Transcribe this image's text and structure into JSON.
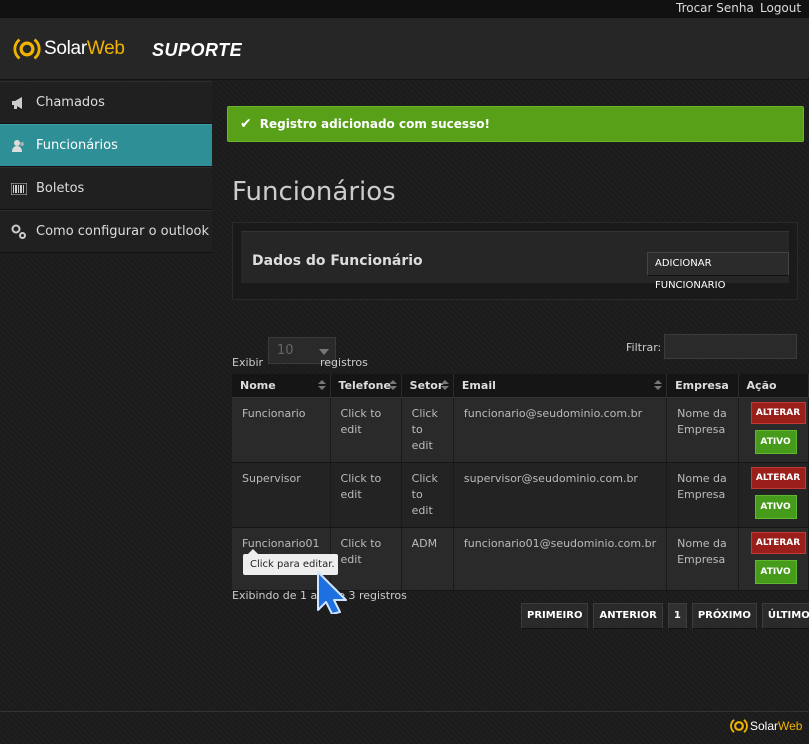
{
  "topbar": {
    "change_password": "Trocar Senha",
    "logout": "Logout"
  },
  "header": {
    "brand_a": "Solar",
    "brand_b": "Web",
    "section": "SUPORTE"
  },
  "sidebar": {
    "items": [
      {
        "label": "Chamados",
        "icon": "megaphone-icon"
      },
      {
        "label": "Funcionários",
        "icon": "users-icon"
      },
      {
        "label": "Boletos",
        "icon": "barcode-icon"
      },
      {
        "label": "Como configurar o outlook",
        "icon": "gears-icon"
      }
    ]
  },
  "alert": {
    "message": "Registro adicionado com sucesso!",
    "color": "#57a018"
  },
  "page": {
    "title": "Funcionários"
  },
  "panel": {
    "title": "Dados do Funcionário",
    "add_button": "ADICIONAR FUNCIONARIO"
  },
  "table_controls": {
    "show_label": "Exibir",
    "page_size": "10",
    "records_label": "registros",
    "filter_label": "Filtrar:"
  },
  "table": {
    "headers": [
      "Nome",
      "Telefone",
      "Setor",
      "Email",
      "Empresa",
      "Ação"
    ],
    "rows": [
      {
        "nome": "Funcionario",
        "telefone": "Click to edit",
        "setor": "Click to edit",
        "email": "funcionario@seudominio.com.br",
        "empresa": "Nome da Empresa",
        "alterar": "ALTERAR",
        "ativo": "ATIVO"
      },
      {
        "nome": "Supervisor",
        "telefone": "Click to edit",
        "setor": "Click to edit",
        "email": "supervisor@seudominio.com.br",
        "empresa": "Nome da Empresa",
        "alterar": "ALTERAR",
        "ativo": "ATIVO"
      },
      {
        "nome": "Funcionario01",
        "telefone": "Click to edit",
        "setor": "ADM",
        "email": "funcionario01@seudominio.com.br",
        "empresa": "Nome da Empresa",
        "alterar": "ALTERAR",
        "ativo": "ATIVO"
      }
    ]
  },
  "tooltip": {
    "text": "Click para editar."
  },
  "info": {
    "text": "Exibindo de 1 a 3 de 3 registros"
  },
  "pagination": {
    "first": "PRIMEIRO",
    "prev": "ANTERIOR",
    "current": "1",
    "next": "PRÓXIMO",
    "last": "ÚLTIMO"
  },
  "footer": {
    "brand_a": "Solar",
    "brand_b": "Web"
  }
}
